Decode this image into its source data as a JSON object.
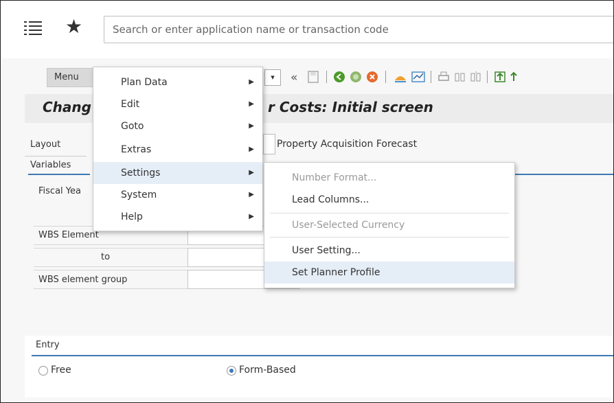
{
  "shell": {
    "search_placeholder": "Search or enter application name or transaction code"
  },
  "toolbar": {
    "menu_label": "Menu",
    "dropdown_glyph": "▾",
    "icons": [
      "back-double-arrow",
      "save",
      "back",
      "exit",
      "cancel",
      "graphic",
      "chart",
      "print",
      "find",
      "find-next",
      "first-page"
    ]
  },
  "title": {
    "part1": "Chang",
    "part2": "r Costs: Initial screen"
  },
  "form": {
    "layout_label": "Layout",
    "layout_value": "Property Acquisition Forecast",
    "variables_label": "Variables",
    "fiscal_year_label": "Fiscal Yea",
    "wbs_element_label": "WBS Element",
    "to_label": "to",
    "wbs_group_label": "WBS element group"
  },
  "entry": {
    "label": "Entry",
    "options": [
      {
        "label": "Free",
        "selected": false
      },
      {
        "label": "Form-Based",
        "selected": true
      }
    ]
  },
  "menu": {
    "items": [
      {
        "label": "Plan Data",
        "has_submenu": true
      },
      {
        "label": "Edit",
        "has_submenu": true
      },
      {
        "label": "Goto",
        "has_submenu": true
      },
      {
        "label": "Extras",
        "has_submenu": true
      },
      {
        "label": "Settings",
        "has_submenu": true,
        "highlighted": true
      },
      {
        "label": "System",
        "has_submenu": true
      },
      {
        "label": "Help",
        "has_submenu": true
      }
    ]
  },
  "settings_submenu": {
    "items": [
      {
        "label": "Number Format...",
        "enabled": false
      },
      {
        "label": "Lead Columns...",
        "enabled": true
      },
      {
        "label": "User-Selected Currency",
        "enabled": false
      },
      {
        "label": "User Setting...",
        "enabled": true
      },
      {
        "label": "Set Planner Profile",
        "enabled": true,
        "highlighted": true
      }
    ]
  },
  "colors": {
    "accent": "#3d79b4",
    "highlight": "#e5eef7",
    "title_bg": "#ececec"
  }
}
